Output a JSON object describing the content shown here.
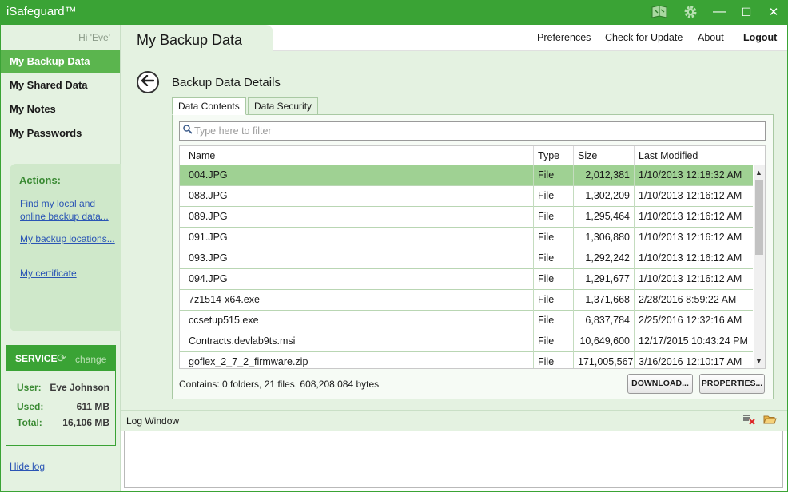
{
  "window": {
    "title": "iSafeguard™",
    "icons": [
      "book-icon",
      "gear-icon"
    ],
    "controls": {
      "minimize": "—",
      "maximize": "☐",
      "close": "✕"
    }
  },
  "sidebar": {
    "greeting": "Hi 'Eve'",
    "nav": [
      {
        "label": "My Backup Data",
        "active": true
      },
      {
        "label": "My Shared Data",
        "active": false
      },
      {
        "label": "My Notes",
        "active": false
      },
      {
        "label": "My Passwords",
        "active": false
      }
    ],
    "actions": {
      "title": "Actions:",
      "links": [
        "Find my local and",
        "online backup data...",
        "My backup locations...",
        "My certificate"
      ]
    },
    "service": {
      "label": "SERVICE",
      "change": "change",
      "user_label": "User:",
      "user": "Eve Johnson",
      "used_label": "Used:",
      "used": "611 MB",
      "total_label": "Total:",
      "total": "16,106 MB"
    },
    "hide_log": "Hide log"
  },
  "header": {
    "page_title": "My Backup Data",
    "links": {
      "preferences": "Preferences",
      "update": "Check for Update",
      "about": "About",
      "logout": "Logout"
    }
  },
  "details": {
    "title": "Backup Data Details",
    "tabs": [
      "Data Contents",
      "Data Security"
    ],
    "filter_placeholder": "Type here to filter",
    "columns": [
      "Name",
      "Type",
      "Size",
      "Last Modified"
    ],
    "rows": [
      {
        "name": "004.JPG",
        "type": "File",
        "size": "2,012,381",
        "modified": "1/10/2013 12:18:32 AM",
        "selected": true
      },
      {
        "name": "088.JPG",
        "type": "File",
        "size": "1,302,209",
        "modified": "1/10/2013 12:16:12 AM"
      },
      {
        "name": "089.JPG",
        "type": "File",
        "size": "1,295,464",
        "modified": "1/10/2013 12:16:12 AM"
      },
      {
        "name": "091.JPG",
        "type": "File",
        "size": "1,306,880",
        "modified": "1/10/2013 12:16:12 AM"
      },
      {
        "name": "093.JPG",
        "type": "File",
        "size": "1,292,242",
        "modified": "1/10/2013 12:16:12 AM"
      },
      {
        "name": "094.JPG",
        "type": "File",
        "size": "1,291,677",
        "modified": "1/10/2013 12:16:12 AM"
      },
      {
        "name": "7z1514-x64.exe",
        "type": "File",
        "size": "1,371,668",
        "modified": "2/28/2016 8:59:22 AM"
      },
      {
        "name": "ccsetup515.exe",
        "type": "File",
        "size": "6,837,784",
        "modified": "2/25/2016 12:32:16 AM"
      },
      {
        "name": "Contracts.devlab9ts.msi",
        "type": "File",
        "size": "10,649,600",
        "modified": "12/17/2015 10:43:24 PM"
      },
      {
        "name": "goflex_2_7_2_firmware.zip",
        "type": "File",
        "size": "171,005,567",
        "modified": "3/16/2016 12:10:17 AM"
      }
    ],
    "status": "Contains: 0 folders, 21 files, 608,208,084 bytes",
    "buttons": {
      "download": "DOWNLOAD...",
      "properties": "PROPERTIES..."
    }
  },
  "log": {
    "title": "Log Window",
    "icons": [
      "clear-log-icon",
      "open-folder-icon"
    ]
  },
  "colors": {
    "brand": "#3aa335",
    "nav_active": "#5bb54e",
    "selected_row": "#9fd193",
    "panel_bg": "#e4f2e1"
  }
}
